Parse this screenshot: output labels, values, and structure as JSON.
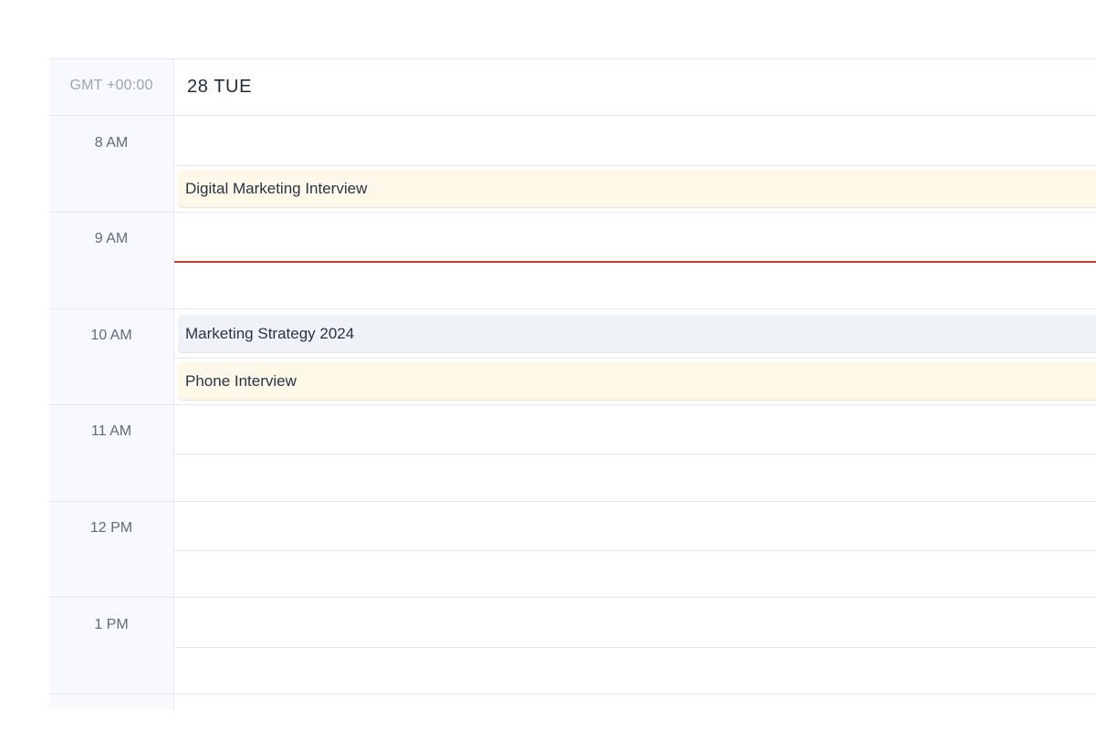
{
  "calendar": {
    "timezone_label": "GMT +00:00",
    "day_header": "28 TUE",
    "hours": [
      "8 AM",
      "9 AM",
      "10 AM",
      "11 AM",
      "12 PM",
      "1 PM"
    ],
    "events": [
      {
        "title": "Digital Marketing Interview",
        "color": "#fdf8e8"
      },
      {
        "title": "Marketing Strategy 2024",
        "color": "#eff2f7"
      },
      {
        "title": "Phone Interview",
        "color": "#fdf8e8"
      }
    ],
    "now_indicator_color": "#d9362b"
  }
}
